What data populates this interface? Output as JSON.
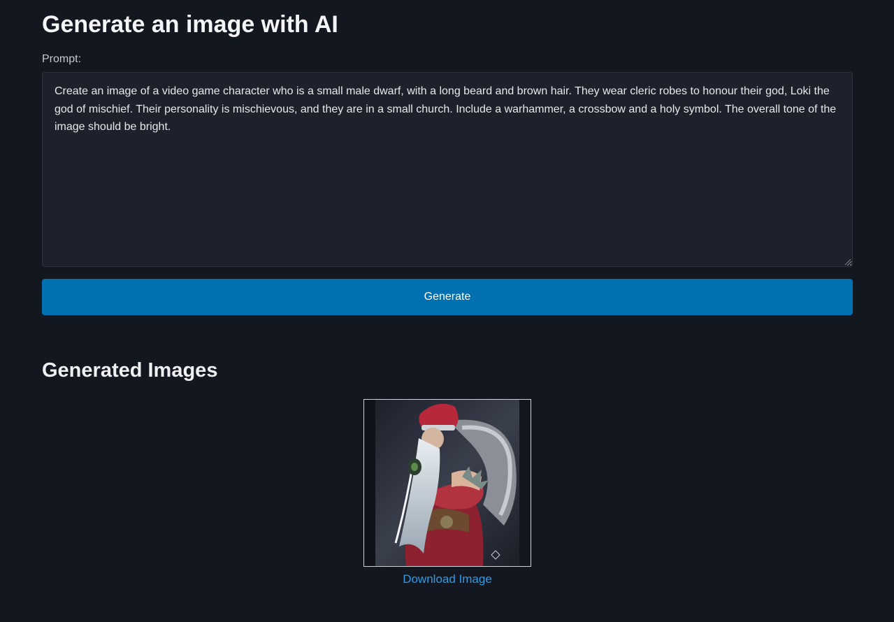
{
  "page": {
    "title": "Generate an image with AI"
  },
  "form": {
    "prompt_label": "Prompt:",
    "prompt_value": "Create an image of a video game character who is a small male dwarf, with a long beard and brown hair. They wear cleric robes to honour their god, Loki the god of mischief. Their personality is mischievous, and they are in a small church. Include a warhammer, a crossbow and a holy symbol. The overall tone of the image should be bright.",
    "generate_label": "Generate"
  },
  "results": {
    "section_title": "Generated Images",
    "images": [
      {
        "alt": "",
        "download_label": "Download Image"
      }
    ]
  },
  "colors": {
    "background": "#13171f",
    "textarea_bg": "#1e212b",
    "button_bg": "#0070b0",
    "link": "#2d9be6"
  }
}
